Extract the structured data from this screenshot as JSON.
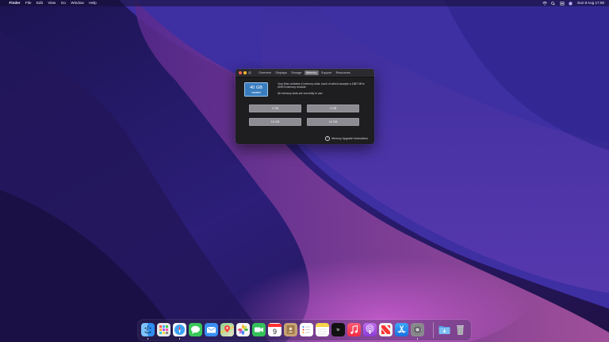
{
  "menubar": {
    "apple": "",
    "app_name": "Finder",
    "items": [
      "File",
      "Edit",
      "View",
      "Go",
      "Window",
      "Help"
    ],
    "clock": "Sun 8 Aug  17:09"
  },
  "window": {
    "tabs": [
      "Overview",
      "Displays",
      "Storage",
      "Memory",
      "Support",
      "Resources"
    ],
    "active_tab": "Memory",
    "badge_amount": "40 GB",
    "badge_label": "Installed",
    "description": "Your Mac contains 4 memory slots, each of which accepts a 1867 MHz DDR3 memory module.",
    "status": "All memory slots are currently in use.",
    "slots": [
      "4 GB",
      "4 GB",
      "16 GB",
      "16 GB"
    ],
    "upgrade_icon": "?",
    "upgrade_link": "Memory Upgrade Instructions"
  },
  "dock": {
    "apps": [
      {
        "name": "Finder",
        "icon": "finder-icon",
        "color": "#2f8df0"
      },
      {
        "name": "Launchpad",
        "icon": "launchpad-icon",
        "color": "#e8e8ec"
      },
      {
        "name": "Safari",
        "icon": "safari-icon",
        "color": "#3aa2f5"
      },
      {
        "name": "Messages",
        "icon": "messages-icon",
        "color": "#38c759"
      },
      {
        "name": "Mail",
        "icon": "mail-icon",
        "color": "#3a8ff2"
      },
      {
        "name": "Maps",
        "icon": "maps-icon",
        "color": "#58b86a"
      },
      {
        "name": "Photos",
        "icon": "photos-icon",
        "color": "#f5f5f5"
      },
      {
        "name": "FaceTime",
        "icon": "facetime-icon",
        "color": "#34c05a"
      },
      {
        "name": "Calendar",
        "icon": "calendar-icon",
        "color": "#ffffff"
      },
      {
        "name": "Contacts",
        "icon": "contacts-icon",
        "color": "#c6a476"
      },
      {
        "name": "Reminders",
        "icon": "reminders-icon",
        "color": "#ffffff"
      },
      {
        "name": "Notes",
        "icon": "notes-icon",
        "color": "#f8d34a"
      },
      {
        "name": "TV",
        "icon": "tv-icon",
        "color": "#111111"
      },
      {
        "name": "Music",
        "icon": "music-icon",
        "color": "#f7445a"
      },
      {
        "name": "Podcasts",
        "icon": "podcasts-icon",
        "color": "#9b4de0"
      },
      {
        "name": "News",
        "icon": "news-icon",
        "color": "#f2f2f2"
      },
      {
        "name": "App Store",
        "icon": "appstore-icon",
        "color": "#2d8cf0"
      },
      {
        "name": "System Preferences",
        "icon": "system-preferences-icon",
        "color": "#8a8a8f"
      },
      {
        "name": "Downloads",
        "icon": "downloads-folder-icon",
        "color": "#58a6e8"
      },
      {
        "name": "Trash",
        "icon": "trash-icon",
        "color": "#b8b8be"
      }
    ],
    "calendar_day": "9",
    "tv_label": "tv"
  }
}
